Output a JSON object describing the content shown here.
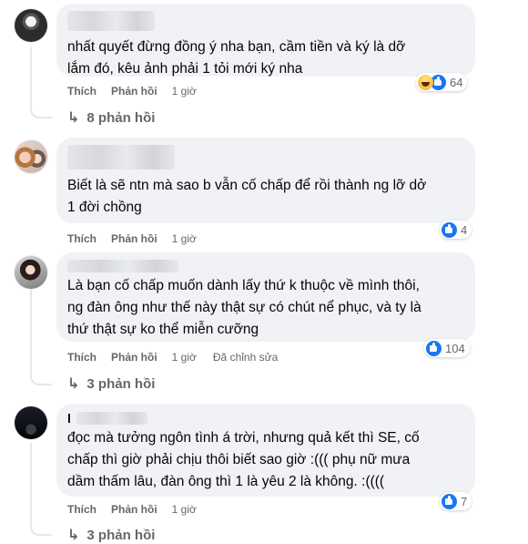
{
  "comments": [
    {
      "text_lines": [
        "nhất quyết đừng đồng ý nha bạn, cầm tiền và ký là dỡ",
        "lắm đó, kêu ảnh phải 1 tỏi mới ký nha"
      ],
      "actions": {
        "like": "Thích",
        "reply": "Phản hồi",
        "time": "1 giờ"
      },
      "reaction_count": "64",
      "replies": "8 phản hồi"
    },
    {
      "text_lines": [
        "Biết là sẽ ntn mà sao b vẫn cố chấp để rồi thành ng lỡ dở",
        "1 đời chồng"
      ],
      "actions": {
        "like": "Thích",
        "reply": "Phản hồi",
        "time": "1 giờ"
      },
      "reaction_count": "4"
    },
    {
      "text_lines": [
        "Là bạn cố chấp muốn dành lấy thứ k thuộc về mình thôi,",
        "ng đàn ông như thế này thật sự có chút nể phục, và ty là",
        "thứ thật sự ko thể miễn cưỡng"
      ],
      "actions": {
        "like": "Thích",
        "reply": "Phản hồi",
        "time": "1 giờ",
        "edited": "Đã chỉnh sửa"
      },
      "reaction_count": "104",
      "replies": "3 phản hồi"
    },
    {
      "name_initial": "l",
      "text_lines": [
        "đọc mà tưởng ngôn tình á trời, nhưng quả kết thì SE, cố",
        "chấp thì giờ phải chịu thôi biết sao giờ :((( phụ nữ mưa",
        "dầm thấm lâu, đàn ông thì 1 là yêu 2 là không. :(((("
      ],
      "actions": {
        "like": "Thích",
        "reply": "Phản hồi",
        "time": "1 giờ"
      },
      "reaction_count": "7",
      "replies": "3 phản hồi"
    }
  ],
  "icons": {
    "like": "like-icon",
    "haha": "haha-icon",
    "reply_arrow": "reply-arrow-icon"
  },
  "colors": {
    "bubble": "#f0f2f5",
    "like_blue": "#1877f2",
    "meta_gray": "#65676b"
  }
}
